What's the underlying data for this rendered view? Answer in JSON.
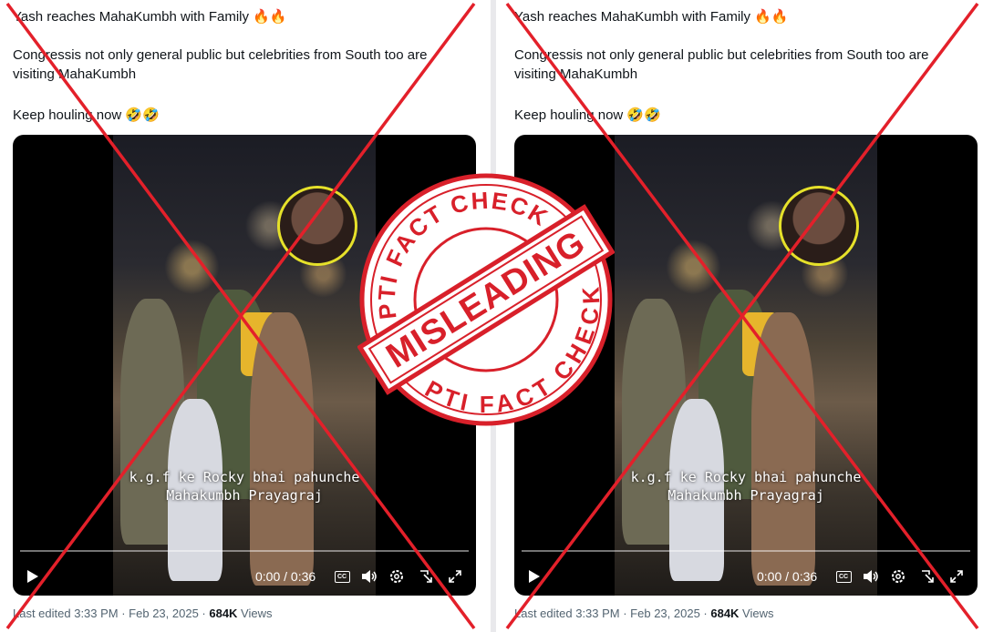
{
  "post": {
    "title": "Yash reaches MahaKumbh with Family 🔥🔥",
    "body1": "Congressis not only general public but celebrities from South too are visiting MahaKumbh",
    "body2": "Keep houling  now 🤣🤣"
  },
  "video": {
    "caption_line1": "k.g.f ke Rocky bhai pahunche",
    "caption_line2": "Mahakumbh Prayagraj",
    "time": "0:00 / 0:36",
    "progress_fraction": 0.0,
    "icons": [
      "play-icon",
      "captions-icon",
      "volume-icon",
      "settings-icon",
      "minimize-icon",
      "fullscreen-icon"
    ],
    "cc_label": "CC"
  },
  "footer": {
    "prefix": "Last edited 3:33 PM · Feb 23, 2025 · ",
    "views_count": "684K",
    "views_label": " Views"
  },
  "stamp": {
    "top_text": "PTI FACT CHECK",
    "bottom_text": "PTI FACT CHECK",
    "center_text": "MISLEADING",
    "color": "#d8202a"
  },
  "cross_color": "#e3202a"
}
